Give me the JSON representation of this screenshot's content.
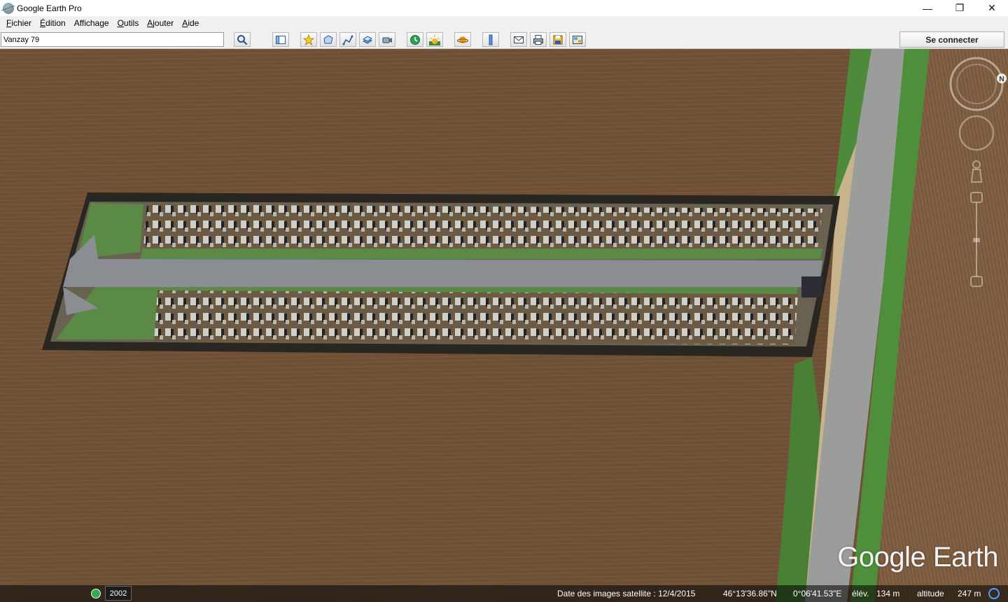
{
  "window": {
    "title": "Google Earth Pro",
    "minimize": "—",
    "maximize": "❐",
    "close": "✕"
  },
  "menu": [
    {
      "acc": "F",
      "rest": "ichier"
    },
    {
      "acc": "É",
      "rest": "dition"
    },
    {
      "acc": "",
      "rest": "Affichage"
    },
    {
      "acc": "O",
      "rest": "utils"
    },
    {
      "acc": "A",
      "rest": "jouter"
    },
    {
      "acc": "A",
      "rest": "ide"
    }
  ],
  "search": {
    "value": "Vanzay 79"
  },
  "toolbar": {
    "connect_label": "Se connecter",
    "icons": [
      "search-icon",
      "sidebar-icon",
      "placemark-icon",
      "polygon-icon",
      "path-icon",
      "overlay-icon",
      "tour-icon",
      "historical-imagery-icon",
      "sunlight-icon",
      "planets-icon",
      "ruler-icon",
      "email-icon",
      "print-icon",
      "save-image-icon",
      "maps-icon"
    ]
  },
  "map": {
    "logo": "Google Earth",
    "north": "N"
  },
  "status": {
    "year": "2002",
    "imagery_date": "Date des images satellite : 12/4/2015",
    "latitude": "46°13'36.86\"N",
    "longitude": "0°06'41.53\"E",
    "elevation_label": "élév.",
    "elevation_value": "134 m",
    "altitude_label": "altitude",
    "altitude_value": "247 m"
  },
  "colors": {
    "field": "#6f5137",
    "grass": "#5a8a45",
    "road": "#9a9d9a",
    "path": "#8a8e92"
  }
}
